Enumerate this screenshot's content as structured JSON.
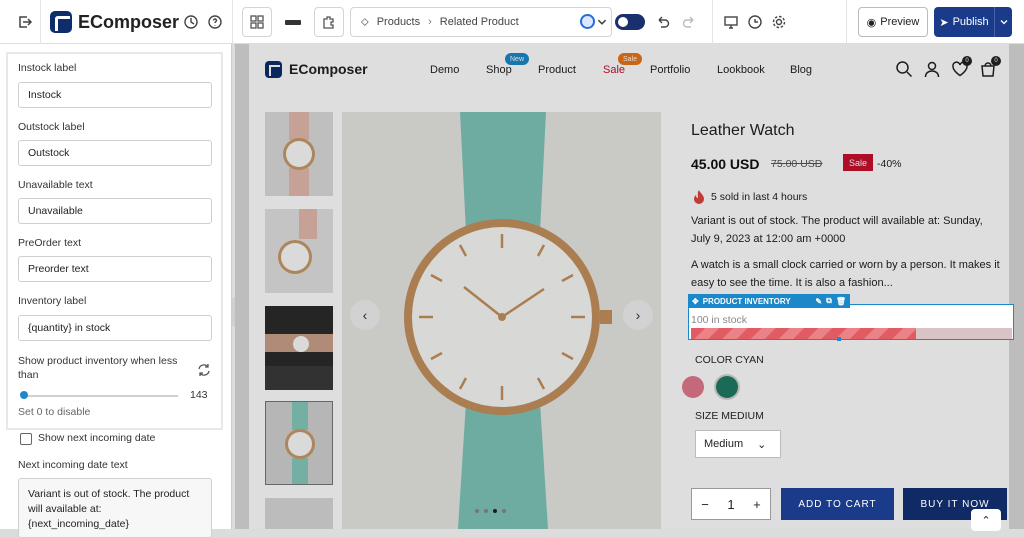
{
  "app": {
    "brand": "EComposer"
  },
  "toolbar": {
    "breadcrumb": [
      "Products",
      "Related Product"
    ],
    "preview_label": "Preview",
    "publish_label": "Publish"
  },
  "panel": {
    "fields": [
      {
        "label": "Instock label",
        "value": "Instock"
      },
      {
        "label": "Outstock label",
        "value": "Outstock"
      },
      {
        "label": "Unavailable text",
        "value": "Unavailable"
      },
      {
        "label": "PreOrder text",
        "value": "Preorder text"
      },
      {
        "label": "Inventory label",
        "value": "{quantity} in stock"
      }
    ],
    "show_inventory_label": "Show product inventory when less than",
    "slider_value": "143",
    "hint": "Set 0 to disable",
    "show_next_date_label": "Show next incoming date",
    "next_date_text_label": "Next incoming date text",
    "next_date_text_value": "Variant is out of stock. The product will available at: {next_incoming_date}"
  },
  "store": {
    "brand": "EComposer",
    "nav": [
      "Demo",
      "Shop",
      "Product",
      "Sale",
      "Portfolio",
      "Lookbook",
      "Blog"
    ],
    "badge_new": "New",
    "badge_sale": "Sale",
    "wishlist_count": "0",
    "cart_count": "0"
  },
  "product": {
    "title": "Leather Watch",
    "price": "45.00 USD",
    "compare_price": "75.00 USD",
    "sale_badge": "Sale",
    "discount": "-40%",
    "sold_text": "5 sold in last 4 hours",
    "stock_notice": "Variant is out of stock. The product will available at: Sunday, July 9, 2023 at 12:00 am +0000",
    "description": "A watch is a small clock carried or worn by a person. It makes it easy to see the time. It is also a fashion...",
    "inventory_tag": "PRODUCT INVENTORY",
    "inventory_text": "100 in stock",
    "inventory_fraction": 0.7,
    "color_label": "COLOR CYAN",
    "size_label": "SIZE MEDIUM",
    "size_value": "Medium",
    "qty_minus": "−",
    "qty": "1",
    "qty_plus": "+",
    "add_to_cart": "ADD TO CART",
    "buy_it_now": "BUY IT NOW"
  },
  "colors": {
    "accent": "#1a88c9",
    "brand": "#1a3a8a",
    "sale": "#c8102e",
    "swatch_pink": "#e0707f",
    "swatch_teal": "#1e7a63"
  }
}
